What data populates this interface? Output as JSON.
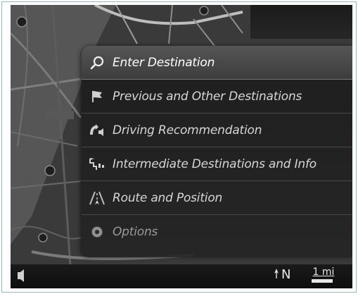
{
  "menu": {
    "items": [
      {
        "label": "Enter Destination",
        "icon": "search-icon"
      },
      {
        "label": "Previous and Other Destinations",
        "icon": "flag-icon"
      },
      {
        "label": "Driving Recommendation",
        "icon": "voice-guidance-icon"
      },
      {
        "label": "Intermediate Destinations and Info",
        "icon": "waypoint-icon"
      },
      {
        "label": "Route and Position",
        "icon": "route-icon"
      },
      {
        "label": "Options",
        "icon": "options-icon"
      }
    ],
    "selected_index": 0
  },
  "map": {
    "compass": "N",
    "scale": "1 mi"
  },
  "colors": {
    "menu_bg": "#1c1c1c",
    "selected_bg": "#4a4a4a",
    "text": "#d6d6d6"
  }
}
